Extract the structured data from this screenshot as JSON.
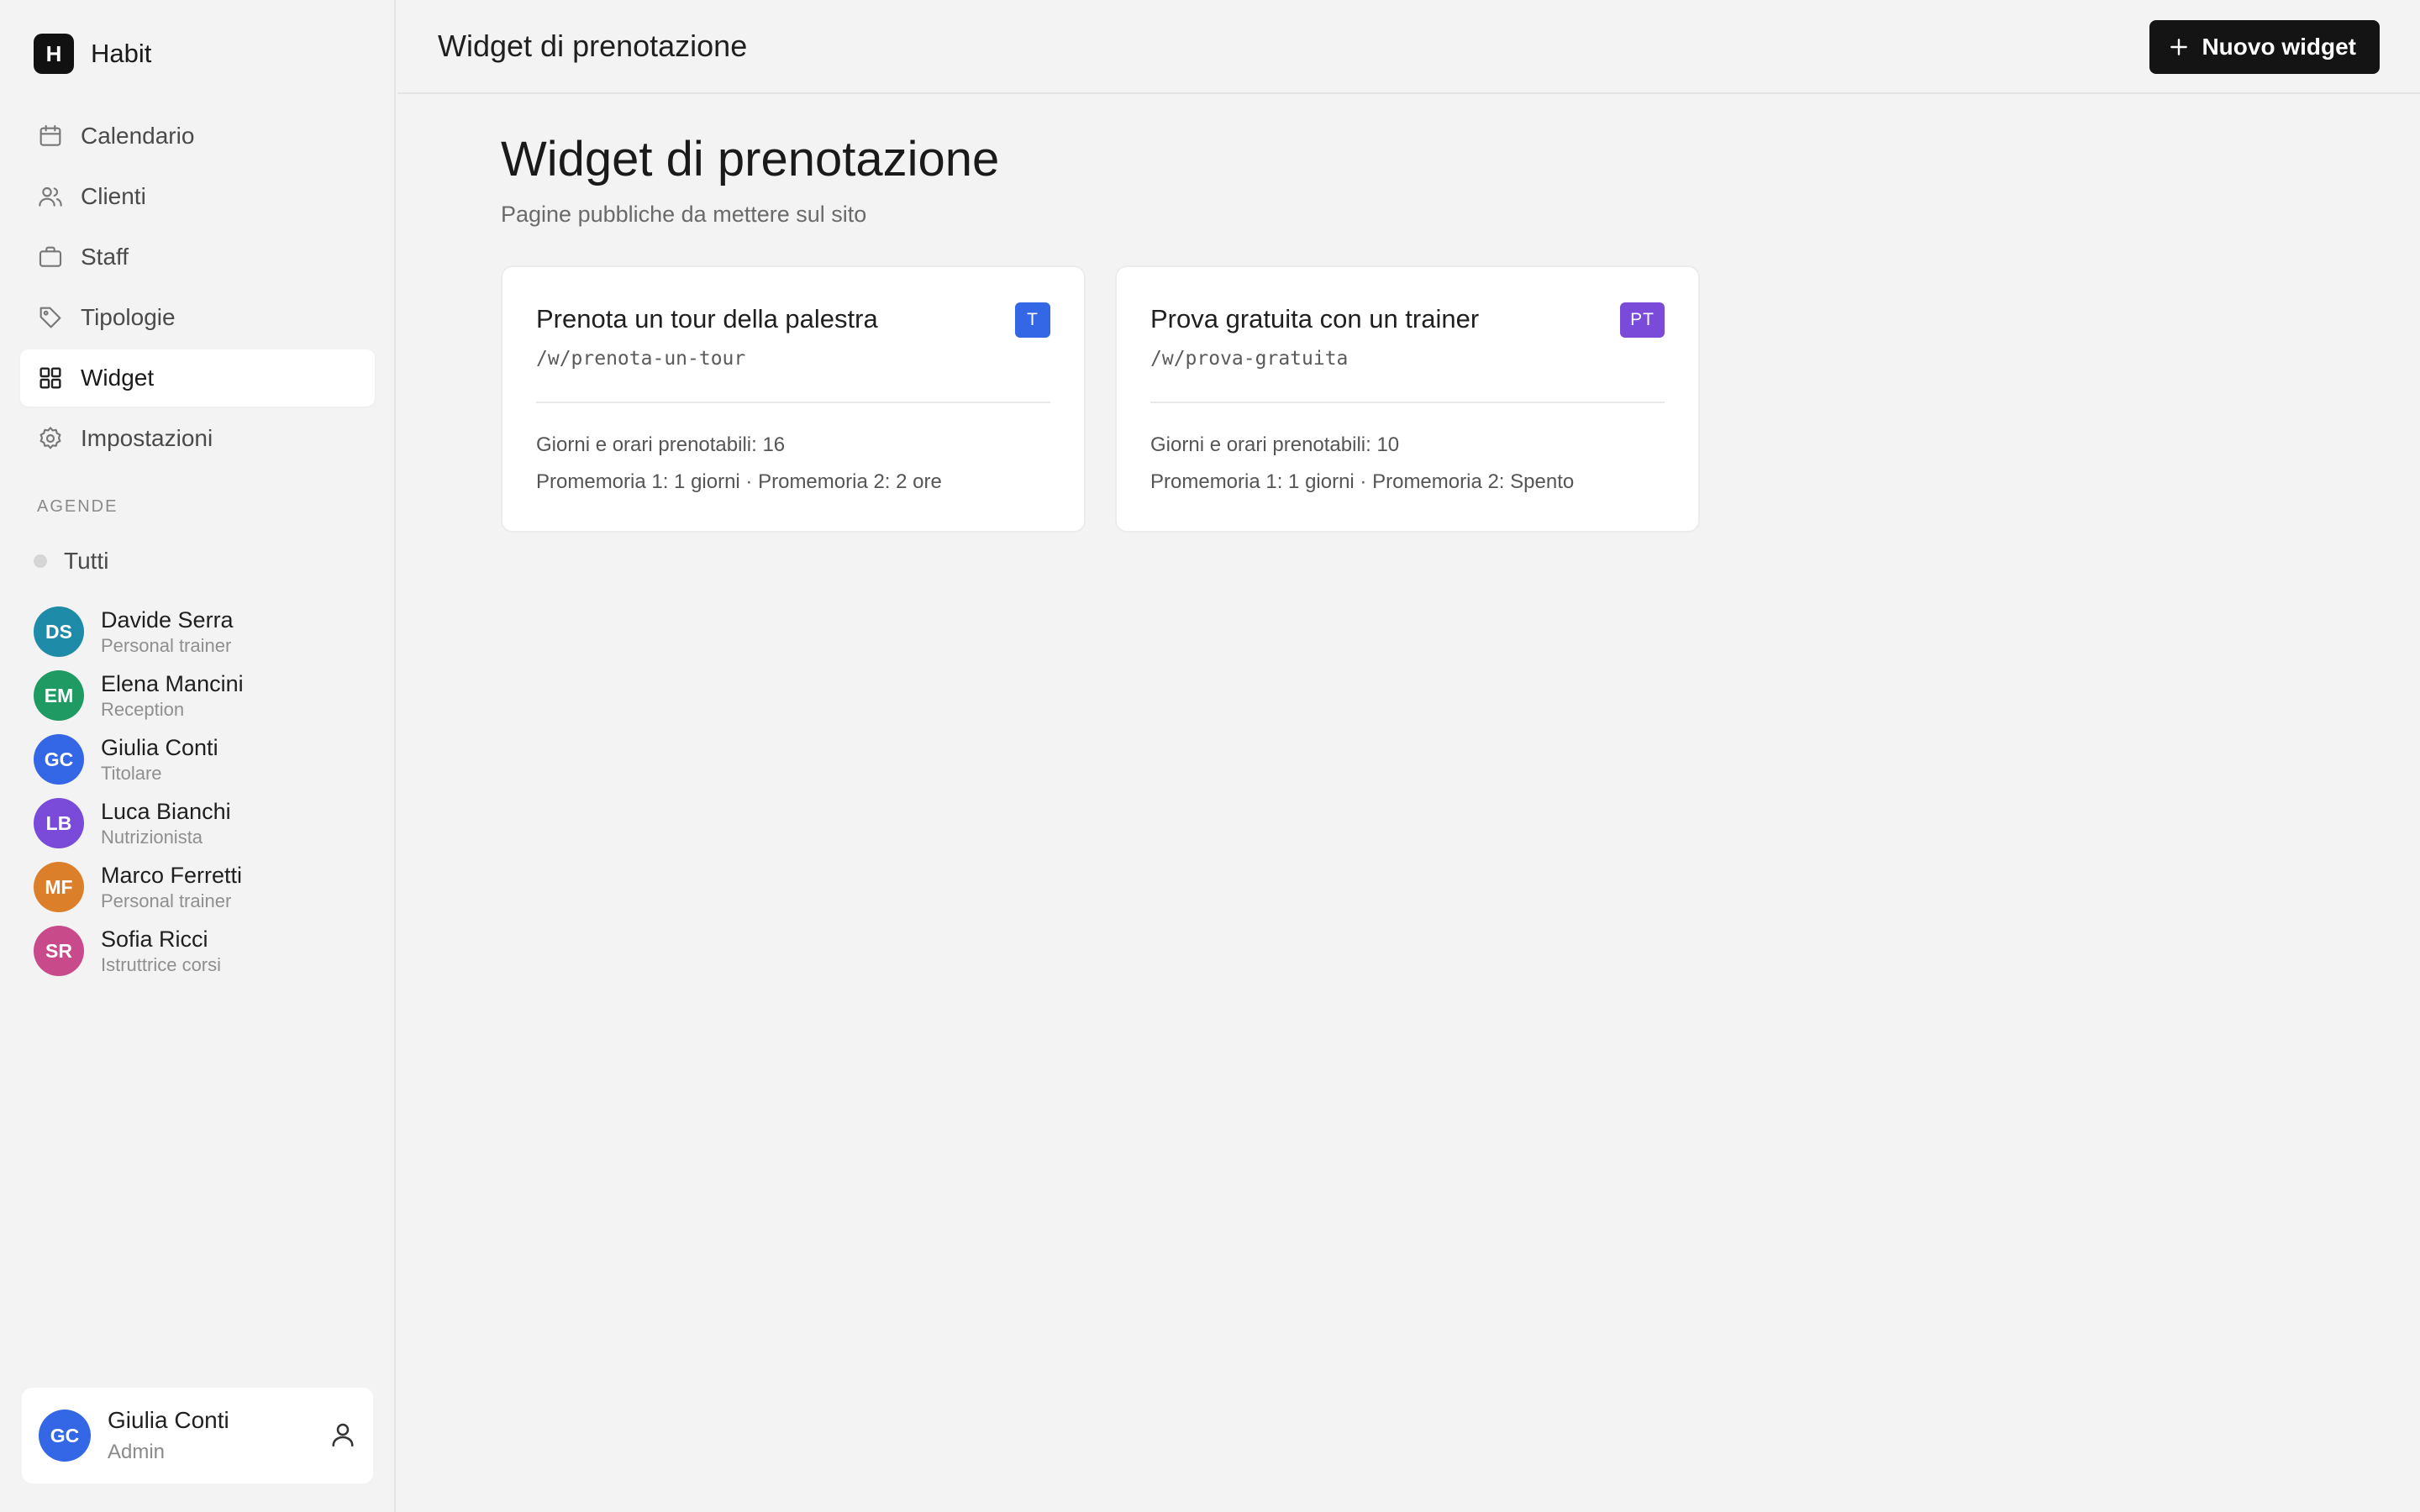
{
  "app": {
    "logo_letter": "H",
    "name": "Habit"
  },
  "sidebar": {
    "nav": [
      {
        "label": "Calendario",
        "icon": "calendar-icon"
      },
      {
        "label": "Clienti",
        "icon": "users-icon"
      },
      {
        "label": "Staff",
        "icon": "briefcase-icon"
      },
      {
        "label": "Tipologie",
        "icon": "tag-icon"
      },
      {
        "label": "Widget",
        "icon": "grid-icon",
        "active": true
      },
      {
        "label": "Impostazioni",
        "icon": "gear-icon"
      }
    ],
    "section_label": "AGENDE",
    "all_label": "Tutti",
    "agendas": [
      {
        "initials": "DS",
        "name": "Davide Serra",
        "role": "Personal trainer",
        "color": "#1e8ba8"
      },
      {
        "initials": "EM",
        "name": "Elena Mancini",
        "role": "Reception",
        "color": "#1f9a63"
      },
      {
        "initials": "GC",
        "name": "Giulia Conti",
        "role": "Titolare",
        "color": "#3367e5"
      },
      {
        "initials": "LB",
        "name": "Luca Bianchi",
        "role": "Nutrizionista",
        "color": "#7a4bd8"
      },
      {
        "initials": "MF",
        "name": "Marco Ferretti",
        "role": "Personal trainer",
        "color": "#dc7f2a"
      },
      {
        "initials": "SR",
        "name": "Sofia Ricci",
        "role": "Istruttrice corsi",
        "color": "#c94a8a"
      }
    ],
    "user": {
      "initials": "GC",
      "name": "Giulia Conti",
      "role": "Admin",
      "color": "#3367e5"
    }
  },
  "header": {
    "title": "Widget di prenotazione",
    "new_button_label": "Nuovo widget"
  },
  "main": {
    "title": "Widget di prenotazione",
    "subtitle": "Pagine pubbliche da mettere sul sito",
    "cards": [
      {
        "title": "Prenota un tour della palestra",
        "path": "/w/prenota-un-tour",
        "badge": "T",
        "badge_color": "#3367e5",
        "line1": "Giorni e orari prenotabili: 16",
        "line2": "Promemoria 1: 1 giorni · Promemoria 2: 2 ore"
      },
      {
        "title": "Prova gratuita con un trainer",
        "path": "/w/prova-gratuita",
        "badge": "PT",
        "badge_color": "#7a4bd8",
        "line1": "Giorni e orari prenotabili: 10",
        "line2": "Promemoria 1: 1 giorni · Promemoria 2: Spento"
      }
    ]
  }
}
